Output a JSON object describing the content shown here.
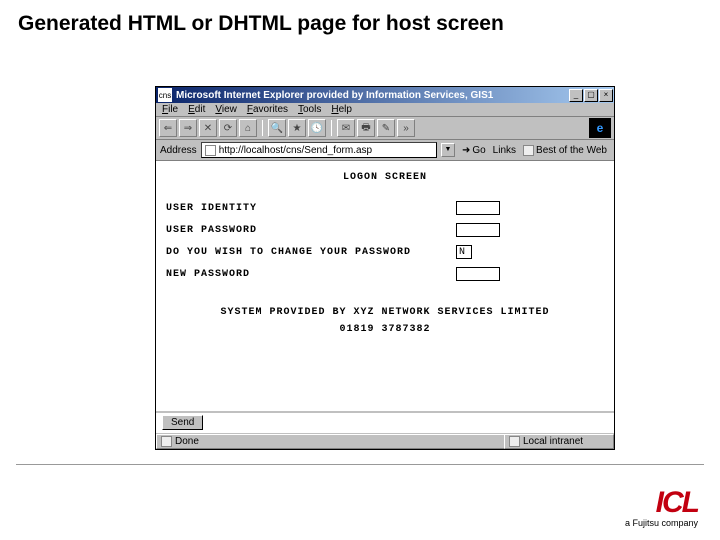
{
  "slide": {
    "title": "Generated HTML or DHTML page for host screen"
  },
  "browser": {
    "title_icon": "cns",
    "title": "Microsoft Internet Explorer provided by Information Services, GIS1",
    "menus": {
      "file": "File",
      "edit": "Edit",
      "view": "View",
      "favorites": "Favorites",
      "tools": "Tools",
      "help": "Help"
    },
    "address_label": "Address",
    "url": "http://localhost/cns/Send_form.asp",
    "go_label": "Go",
    "links_label": "Links",
    "links_item": "Best of the Web",
    "status_left": "Done",
    "status_right": "Local intranet"
  },
  "page": {
    "heading": "LOGON SCREEN",
    "labels": {
      "user_id": "USER IDENTITY",
      "user_pw": "USER PASSWORD",
      "change_pw": "DO YOU WISH TO CHANGE YOUR PASSWORD",
      "new_pw": "NEW PASSWORD"
    },
    "values": {
      "user_id": "",
      "user_pw": "",
      "change_pw": "N",
      "new_pw": ""
    },
    "footer": "SYSTEM PROVIDED BY XYZ NETWORK SERVICES LIMITED",
    "footer_code": "01819 3787382",
    "send_label": "Send"
  },
  "brand": {
    "logo": "ICL",
    "sub": "a Fujitsu company"
  }
}
